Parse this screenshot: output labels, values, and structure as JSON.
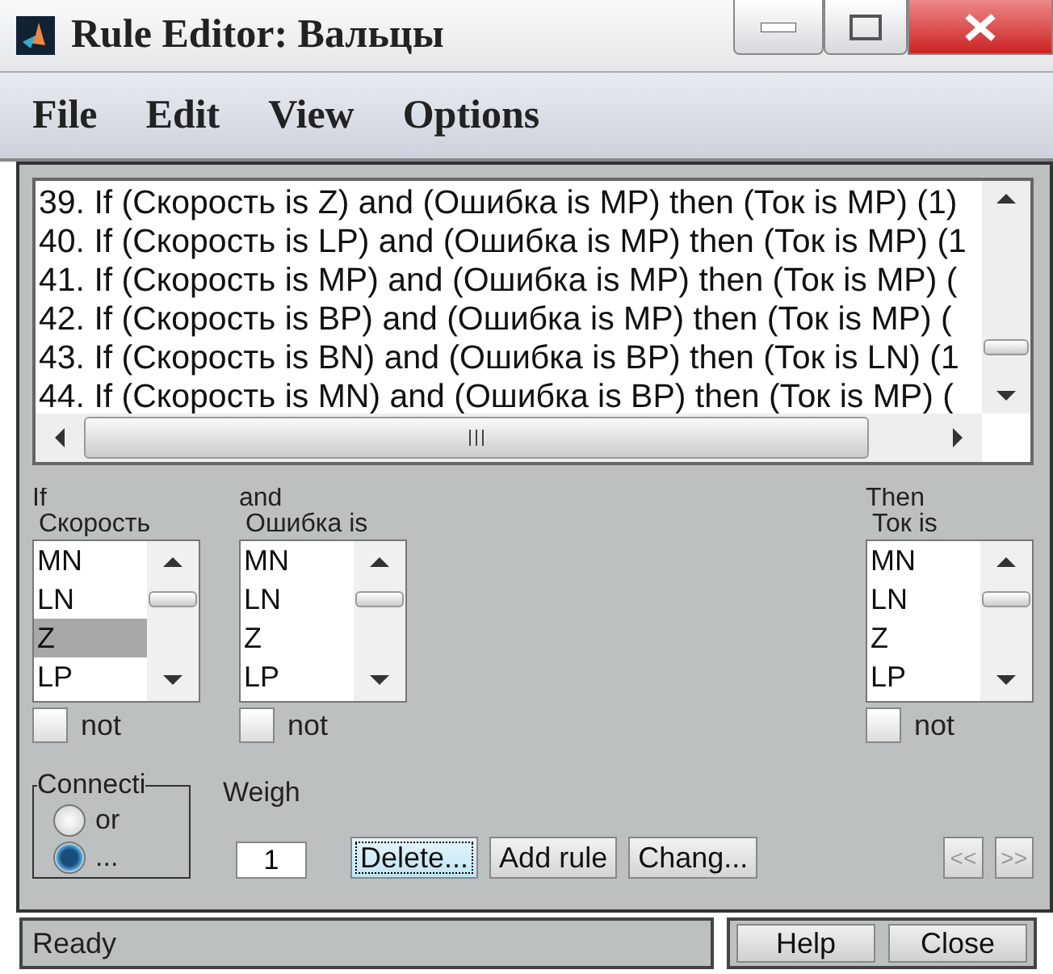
{
  "window": {
    "title": "Rule Editor: Вальцы"
  },
  "menu": [
    "File",
    "Edit",
    "View",
    "Options"
  ],
  "rules": [
    "39. If (Скорость is Z) and (Ошибка is MP) then (Ток is MP) (1)",
    "40. If (Скорость is LP) and (Ошибка is MP) then (Ток is MP) (1",
    "41. If (Скорость is MP) and (Ошибка is MP) then (Ток is MP) (",
    "42. If (Скорость is BP) and (Ошибка is MP) then (Ток is MP) (",
    "43. If (Скорость is BN) and (Ошибка is BP) then (Ток is LN) (1",
    "44. If (Скорость is MN) and (Ошибка is BP) then (Ток is MP) ("
  ],
  "columns": [
    {
      "kind": "input",
      "header": "If",
      "label": "Скорость",
      "not_label": "not",
      "not": false,
      "items": [
        {
          "label": "MN",
          "selected": false
        },
        {
          "label": "LN",
          "selected": false
        },
        {
          "label": "Z",
          "selected": true
        },
        {
          "label": "LP",
          "selected": false
        }
      ]
    },
    {
      "kind": "input",
      "header": "and",
      "label": "Ошибка is",
      "not_label": "not",
      "not": false,
      "items": [
        {
          "label": "MN",
          "selected": false
        },
        {
          "label": "LN",
          "selected": false
        },
        {
          "label": "Z",
          "selected": false
        },
        {
          "label": "LP",
          "selected": false
        }
      ]
    },
    {
      "kind": "output",
      "header": "Then",
      "label": "Ток is",
      "not_label": "not",
      "not": false,
      "items": [
        {
          "label": "MN",
          "selected": false
        },
        {
          "label": "LN",
          "selected": false
        },
        {
          "label": "Z",
          "selected": false
        },
        {
          "label": "LP",
          "selected": false
        }
      ]
    }
  ],
  "connection": {
    "label": "Connecti",
    "options": [
      {
        "label": "or",
        "selected": false
      },
      {
        "label": "...",
        "selected": true
      }
    ]
  },
  "weight": {
    "label": "Weigh",
    "value": "1"
  },
  "buttons": [
    {
      "label": "Delete...",
      "focused": true
    },
    {
      "label": "Add rule",
      "focused": false
    },
    {
      "label": "Chang...",
      "focused": false
    }
  ],
  "nav": [
    {
      "label": "<<",
      "disabled": true
    },
    {
      "label": ">>",
      "disabled": true
    }
  ],
  "status": "Ready",
  "footer_buttons": [
    "Help",
    "Close"
  ]
}
